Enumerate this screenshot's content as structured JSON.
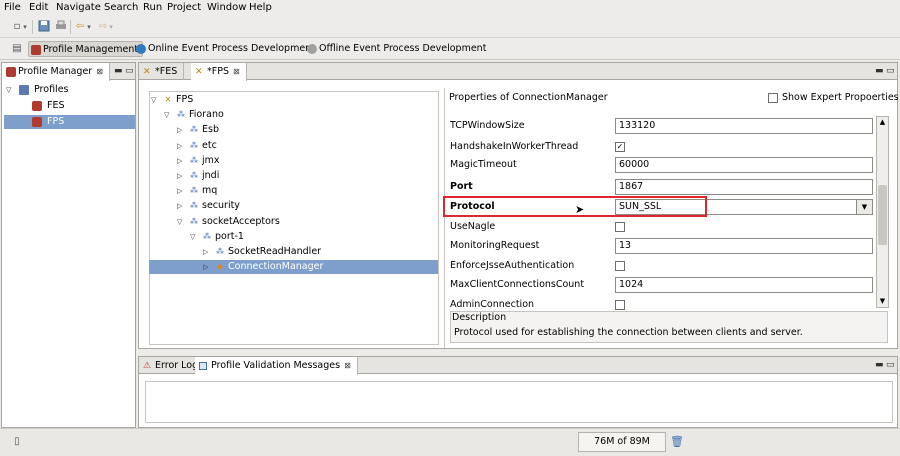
{
  "menu": [
    "File",
    "Edit",
    "Navigate",
    "Search",
    "Run",
    "Project",
    "Window",
    "Help"
  ],
  "toolbar": {
    "icons": [
      "new-wizard-icon",
      "save-icon",
      "print-icon",
      "back-icon",
      "forward-icon"
    ]
  },
  "perspectives": [
    {
      "label": "Profile Management",
      "active": true,
      "icon": "profile-management-icon",
      "color": "#b03a2e"
    },
    {
      "label": "Online Event Process Development",
      "active": false,
      "icon": "online-event-icon",
      "color": "#2e7bbf"
    },
    {
      "label": "Offline Event Process Development",
      "active": false,
      "icon": "offline-event-icon",
      "color": "#9b9b9b"
    }
  ],
  "profile_manager": {
    "tab_label": "Profile Manager",
    "tree": [
      {
        "label": "Profiles",
        "level": 0,
        "expanded": true,
        "icon": "folder-icon"
      },
      {
        "label": "FES",
        "level": 1,
        "icon": "profile-icon"
      },
      {
        "label": "FPS",
        "level": 1,
        "icon": "profile-icon",
        "selected": true
      }
    ]
  },
  "editor": {
    "tabs": [
      {
        "label": "*FES",
        "selected": false
      },
      {
        "label": "*FPS",
        "selected": true
      }
    ],
    "tree": [
      {
        "label": "FPS",
        "level": 0,
        "twisty": "▽"
      },
      {
        "label": "Fiorano",
        "level": 1,
        "twisty": "▽"
      },
      {
        "label": "Esb",
        "level": 2,
        "twisty": "▷"
      },
      {
        "label": "etc",
        "level": 2,
        "twisty": "▷"
      },
      {
        "label": "jmx",
        "level": 2,
        "twisty": "▷"
      },
      {
        "label": "jndi",
        "level": 2,
        "twisty": "▷"
      },
      {
        "label": "mq",
        "level": 2,
        "twisty": "▷"
      },
      {
        "label": "security",
        "level": 2,
        "twisty": "▷"
      },
      {
        "label": "socketAcceptors",
        "level": 2,
        "twisty": "▽"
      },
      {
        "label": "port-1",
        "level": 3,
        "twisty": "▽"
      },
      {
        "label": "SocketReadHandler",
        "level": 4,
        "twisty": "▷"
      },
      {
        "label": "ConnectionManager",
        "level": 4,
        "twisty": "▷",
        "selected": true
      }
    ],
    "properties": {
      "header": "Properties of ConnectionManager",
      "expert_label": "Show Expert Propoerties",
      "rows": [
        {
          "label": "TCPWindowSize",
          "type": "text",
          "value": "133120"
        },
        {
          "label": "HandshakeInWorkerThread",
          "type": "check",
          "checked": true
        },
        {
          "label": "MagicTimeout",
          "type": "text",
          "value": "60000"
        },
        {
          "label": "Port",
          "type": "text",
          "value": "1867",
          "bold": true
        },
        {
          "label": "Protocol",
          "type": "combo",
          "value": "SUN_SSL",
          "bold": true,
          "highlighted": true
        },
        {
          "label": "UseNagle",
          "type": "check",
          "checked": false
        },
        {
          "label": "MonitoringRequest",
          "type": "text",
          "value": "13"
        },
        {
          "label": "EnforceJsseAuthentication",
          "type": "check",
          "checked": false
        },
        {
          "label": "MaxClientConnectionsCount",
          "type": "text",
          "value": "1024"
        },
        {
          "label": "AdminConnection",
          "type": "check",
          "checked": false
        }
      ],
      "description_title": "Description",
      "description_text": "Protocol used for establishing the connection between clients and server."
    }
  },
  "bottom": {
    "tabs": [
      {
        "label": "Error Log",
        "selected": false
      },
      {
        "label": "Profile Validation Messages",
        "selected": true
      }
    ]
  },
  "status": {
    "heap": "76M of 89M"
  },
  "colors": {
    "highlight": "#e0272e",
    "selection": "#7e9fcb"
  }
}
